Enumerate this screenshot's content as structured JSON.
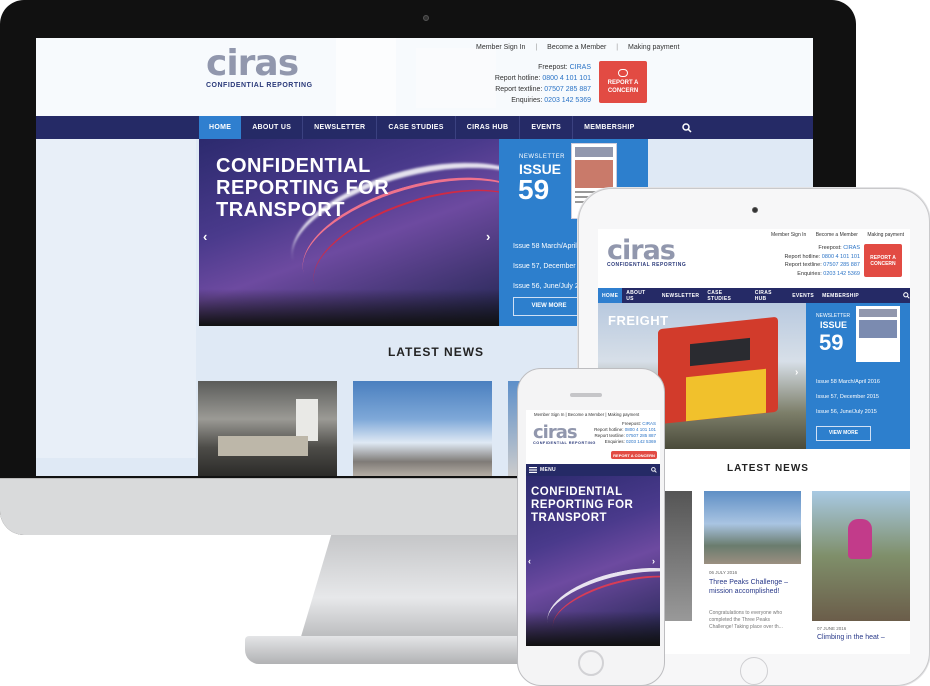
{
  "desktop": {
    "logo": "ciras",
    "logo_sub": "CONFIDENTIAL REPORTING",
    "toplinks": [
      "Member Sign In",
      "Become a Member",
      "Making payment"
    ],
    "contact": [
      {
        "label": "Freepost:",
        "value": "CIRAS"
      },
      {
        "label": "Report hotline:",
        "value": "0800 4 101 101"
      },
      {
        "label": "Report textline:",
        "value": "07507 285 887"
      },
      {
        "label": "Enquiries:",
        "value": "0203 142 5369"
      }
    ],
    "report_btn": "REPORT A CONCERN",
    "nav": [
      "HOME",
      "ABOUT US",
      "NEWSLETTER",
      "CASE STUDIES",
      "CIRAS HUB",
      "EVENTS",
      "MEMBERSHIP"
    ],
    "hero_title": [
      "CONFIDENTIAL",
      "REPORTING FOR",
      "TRANSPORT"
    ],
    "newsletter_label": "NEWSLETTER",
    "issue_label": "ISSUE",
    "issue_number": "59",
    "issues": [
      "Issue 58 March/April",
      "Issue 57, December",
      "Issue 56, June/July 2"
    ],
    "view_more": "VIEW MORE",
    "latest_news": "LATEST NEWS"
  },
  "tablet": {
    "logo": "ciras",
    "logo_sub": "CONFIDENTIAL REPORTING",
    "toplinks": [
      "Member Sign In",
      "Become a Member",
      "Making payment"
    ],
    "contact": [
      {
        "label": "Freepost:",
        "value": "CIRAS"
      },
      {
        "label": "Report hotline:",
        "value": "0800 4 101 101"
      },
      {
        "label": "Report textline:",
        "value": "07507 285 887"
      },
      {
        "label": "Enquiries:",
        "value": "0203 142 5369"
      }
    ],
    "report_btn": "REPORT A CONCERN",
    "nav": [
      "HOME",
      "ABOUT US",
      "NEWSLETTER",
      "CASE STUDIES",
      "CIRAS HUB",
      "EVENTS",
      "MEMBERSHIP"
    ],
    "hero_title": "FREIGHT",
    "newsletter_label": "NEWSLETTER",
    "issue_label": "ISSUE",
    "issue_number": "59",
    "issues": [
      "Issue 58 March/April 2016",
      "Issue 57, December 2015",
      "Issue 56, June/July 2015"
    ],
    "view_more": "VIEW MORE",
    "latest_news": "LATEST NEWS",
    "news": [
      {
        "date": "06 JULY 2016",
        "title": "Three Peaks Challenge – mission accomplished!",
        "excerpt": "Congratulations to everyone who completed the Three Peaks Challenge! Taking place over th..."
      },
      {
        "date": "07 JUNE 2016",
        "title": "Climbing in the heat –"
      }
    ]
  },
  "phone": {
    "toplinks": [
      "Member Sign In",
      "Become a Member",
      "Making payment"
    ],
    "logo": "ciras",
    "logo_sub": "CONFIDENTIAL REPORTING",
    "contact": [
      {
        "label": "Freepost:",
        "value": "CIRAS"
      },
      {
        "label": "Report hotline:",
        "value": "0800 4 101 101"
      },
      {
        "label": "Report textline:",
        "value": "07507 285 887"
      },
      {
        "label": "Enquiries:",
        "value": "0203 142 5369"
      }
    ],
    "report_btn": "REPORT A CONCERN",
    "menu": "MENU",
    "hero_title": [
      "CONFIDENTIAL",
      "REPORTING FOR",
      "TRANSPORT"
    ]
  },
  "colors": {
    "nav": "#252a66",
    "accent": "#2f7fcf",
    "report": "#e24b43"
  }
}
